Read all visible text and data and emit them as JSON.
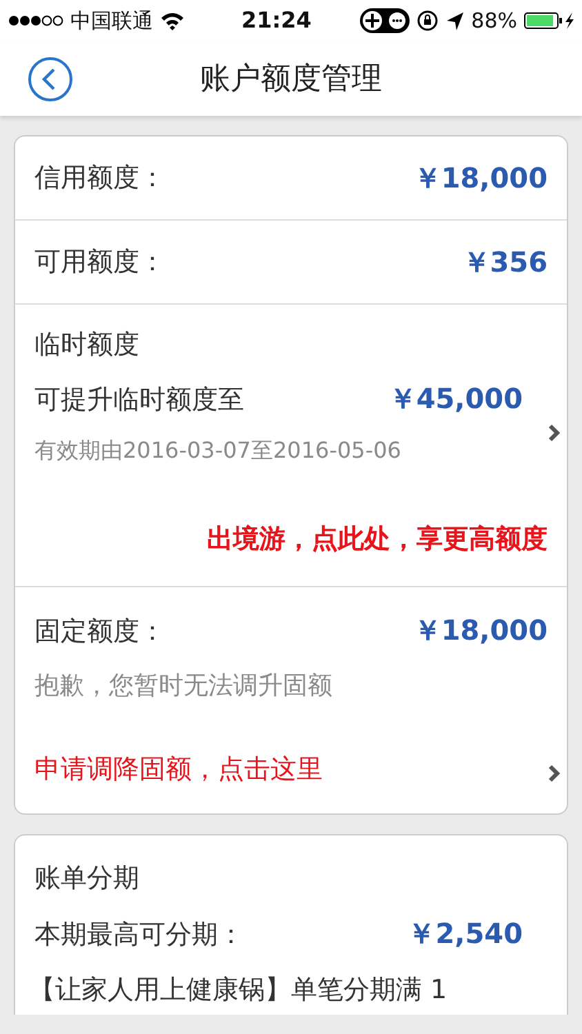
{
  "status_bar": {
    "carrier": "中国联通",
    "time": "21:24",
    "battery": "88%"
  },
  "nav_bar": {
    "title": "账户额度管理"
  },
  "quota_card": {
    "sections": [
      {
        "kind": "amount",
        "label": "信用额度：",
        "amount": "￥18,000"
      },
      {
        "kind": "amount",
        "label": "可用额度：",
        "amount": "￥356"
      },
      {
        "kind": "promo",
        "title": "临时额度",
        "label": "可提升临时额度至",
        "amount": "￥45,000",
        "note": "有效期由2016-03-07至2016-05-06",
        "link": "出境游，点此处，享更高额度"
      },
      {
        "kind": "fixed",
        "label": "固定额度：",
        "amount": "￥18,000",
        "note": "抱歉，您暂时无法调升固额",
        "link": "申请调降固额，点击这里"
      }
    ]
  },
  "installment_card": {
    "title": "账单分期",
    "label": "本期最高可分期：",
    "amount": "￥2,540",
    "text": "【让家人用上健康锅】单笔分期满 1"
  }
}
